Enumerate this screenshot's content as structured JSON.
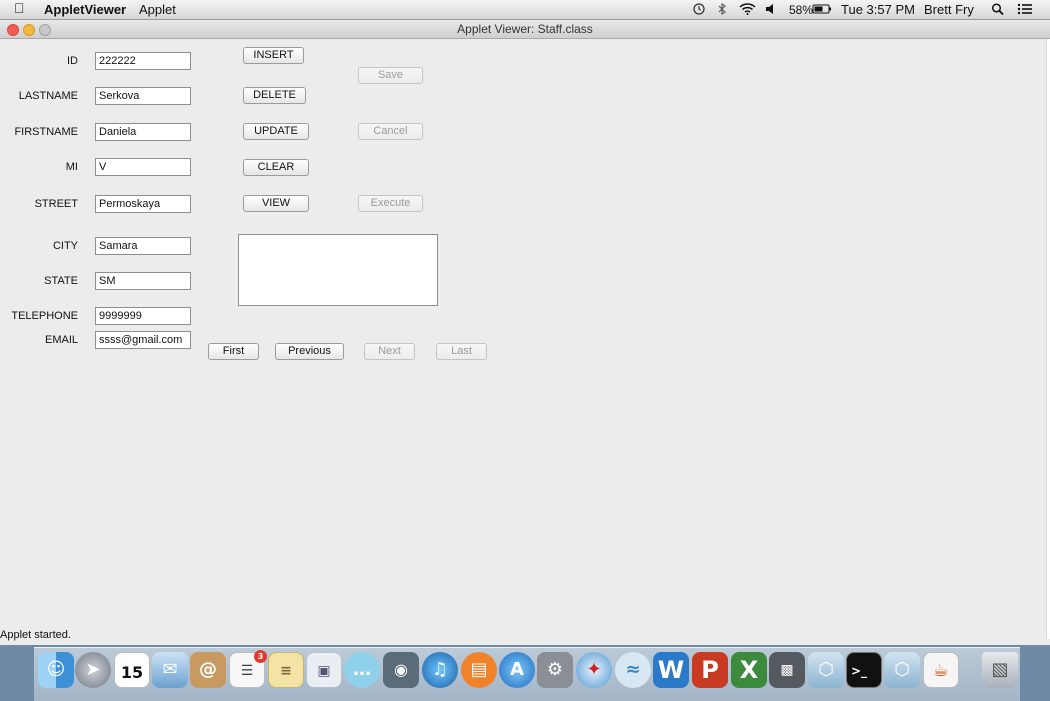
{
  "menubar": {
    "app_name": "AppletViewer",
    "menu_applet": "Applet",
    "battery": "58%",
    "datetime": "Tue 3:57 PM",
    "user": "Brett Fry"
  },
  "window": {
    "title": "Applet Viewer: Staff.class",
    "status": "Applet started."
  },
  "form": {
    "id": {
      "label": "ID",
      "value": "222222"
    },
    "lastname": {
      "label": "LASTNAME",
      "value": "Serkova"
    },
    "firstname": {
      "label": "FIRSTNAME",
      "value": "Daniela"
    },
    "mi": {
      "label": "MI",
      "value": "V"
    },
    "street": {
      "label": "STREET",
      "value": "Permoskaya"
    },
    "city": {
      "label": "CITY",
      "value": "Samara"
    },
    "state": {
      "label": "STATE",
      "value": "SM"
    },
    "telephone": {
      "label": "TELEPHONE",
      "value": "9999999"
    },
    "email": {
      "label": "EMAIL",
      "value": "ssss@gmail.com"
    }
  },
  "buttons": {
    "insert": "INSERT",
    "delete": "DELETE",
    "update": "UPDATE",
    "clear": "CLEAR",
    "view": "VIEW",
    "save": "Save",
    "cancel": "Cancel",
    "execute": "Execute",
    "first": "First",
    "previous": "Previous",
    "next": "Next",
    "last": "Last"
  },
  "dock": {
    "calendar_day": "15",
    "reminders_badge": "3",
    "items": [
      "finder-icon",
      "launchpad-icon",
      "calendar-icon",
      "mail-icon",
      "contacts-icon",
      "reminders-icon",
      "notes-icon",
      "preview-icon",
      "messages-icon",
      "facetime-icon",
      "itunes-icon",
      "ibooks-icon",
      "app-store-icon",
      "system-preferences-icon",
      "safari-icon",
      "wifi-diagnostics-icon",
      "word-icon",
      "powerpoint-icon",
      "excel-icon",
      "photo-booth-icon",
      "virtualbox-icon",
      "terminal-icon",
      "virtualbox-vm-icon",
      "java-icon",
      "trash-icon"
    ]
  }
}
